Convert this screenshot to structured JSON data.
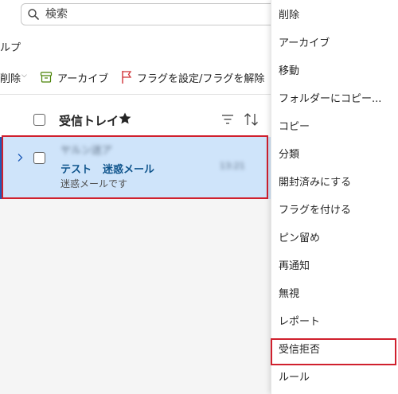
{
  "search": {
    "placeholder": "検索"
  },
  "header": {
    "help_label": "ルプ"
  },
  "toolbar": {
    "delete_label": "削除",
    "archive_label": "アーカイブ",
    "flag_label": "フラグを設定/フラグを解除"
  },
  "list": {
    "title": "受信トレイ",
    "message": {
      "sender": "ヤルン送ア",
      "subject": "テスト",
      "tag": "迷惑メール",
      "preview": "迷惑メールです",
      "time": "13:21"
    }
  },
  "context_menu": {
    "items": [
      {
        "label": "削除"
      },
      {
        "label": "アーカイブ"
      },
      {
        "label": "移動"
      },
      {
        "label": "フォルダーにコピー..."
      },
      {
        "label": "コピー"
      },
      {
        "label": "分類"
      },
      {
        "label": "開封済みにする"
      },
      {
        "label": "フラグを付ける"
      },
      {
        "label": "ピン留め"
      },
      {
        "label": "再通知"
      },
      {
        "label": "無視"
      },
      {
        "label": "レポート"
      },
      {
        "label": "受信拒否"
      },
      {
        "label": "ルール"
      }
    ],
    "highlighted": "受信拒否"
  },
  "colors": {
    "accent": "#1e5bb8",
    "selection": "#cfe4fa",
    "highlight_border": "#d0202e",
    "flag": "#d13438",
    "archive": "#498205"
  }
}
